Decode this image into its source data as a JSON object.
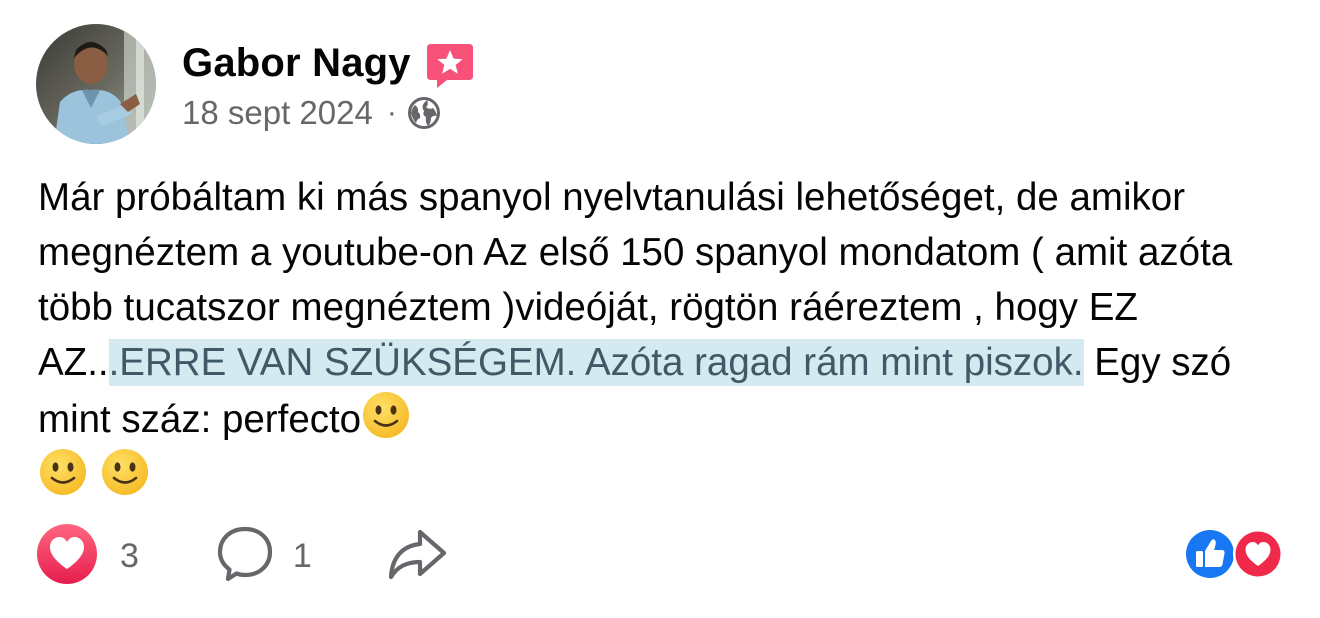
{
  "post": {
    "author": "Gabor Nagy",
    "author_badge_icon": "pink-star-badge-icon",
    "date": "18 sept 2024",
    "separator": "·",
    "audience_icon": "globe-icon",
    "text_part1": "Már próbáltam ki más spanyol nyelvtanulási lehetőséget, de amikor megnéztem a youtube-on Az első 150 spanyol mondatom ( amit azóta több tucatszor megnéztem )videóját, rögtön ráéreztem , hogy EZ AZ..",
    "text_highlight": ".ERRE VAN SZÜKSÉGEM. Azóta ragad rám mint piszok.",
    "text_part2": " Egy szó mint száz: perfecto",
    "emoji_name": "slightly-smiling-face-emoji"
  },
  "footer": {
    "like_icon": "heart-reaction-icon",
    "like_count": "3",
    "comment_icon": "comment-bubble-icon",
    "comment_count": "1",
    "share_icon": "share-arrow-icon",
    "reaction_summary_icons": [
      "thumbs-up-icon",
      "heart-icon"
    ]
  },
  "colors": {
    "highlight_bg": "#d4eaf0",
    "highlight_text": "#3f5a66",
    "meta_text": "#65676b",
    "like_blue": "#1877f2",
    "love_red": "#f0284a",
    "badge_pink": "#f7517a"
  }
}
